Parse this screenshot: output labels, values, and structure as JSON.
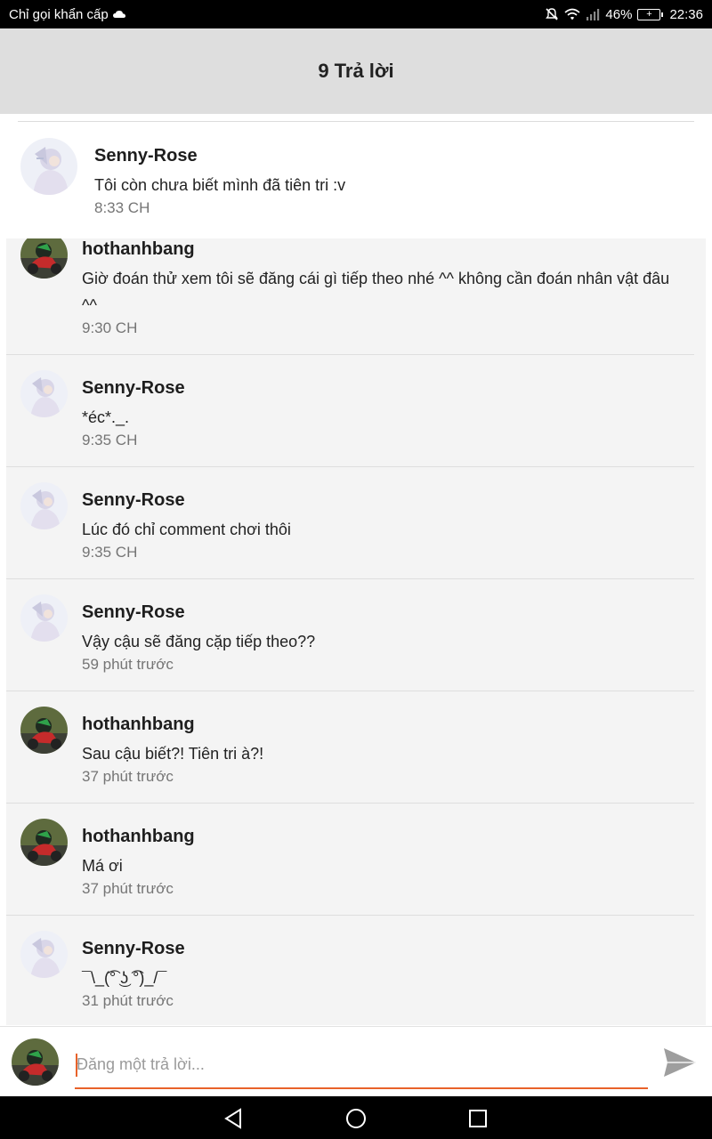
{
  "status_bar": {
    "carrier": "Chỉ gọi khẩn cấp",
    "battery": "46%",
    "time": "22:36"
  },
  "header": {
    "title": "9 Trả lời"
  },
  "top_comment": {
    "author": "Senny-Rose",
    "text": "Tôi còn chưa biết mình đã tiên tri :v",
    "time": "8:33 CH",
    "avatar": "senny-rose-avatar"
  },
  "replies": [
    {
      "author": "hothanhbang",
      "text": "Giờ đoán thử xem tôi sẽ đăng cái gì tiếp theo nhé ^^ không cần đoán nhân vật đâu ^^",
      "time": "9:30 CH",
      "avatar": "hothanhbang-avatar"
    },
    {
      "author": "Senny-Rose",
      "text": "*éc*._.",
      "time": "9:35 CH",
      "avatar": "senny-rose-avatar"
    },
    {
      "author": "Senny-Rose",
      "text": "Lúc đó chỉ comment chơi thôi",
      "time": "9:35 CH",
      "avatar": "senny-rose-avatar"
    },
    {
      "author": "Senny-Rose",
      "text": "Vậy cậu sẽ đăng cặp tiếp theo??",
      "time": "59 phút trước",
      "avatar": "senny-rose-avatar"
    },
    {
      "author": "hothanhbang",
      "text": "Sau cậu biết?! Tiên tri à?!",
      "time": "37 phút trước",
      "avatar": "hothanhbang-avatar"
    },
    {
      "author": "hothanhbang",
      "text": "Má ơi",
      "time": "37 phút trước",
      "avatar": "hothanhbang-avatar"
    },
    {
      "author": "Senny-Rose",
      "text": "¯\\_(͡° ͜ʖ ͡°)_/¯",
      "time": "31 phút trước",
      "avatar": "senny-rose-avatar"
    }
  ],
  "composer": {
    "placeholder": "Đăng một trả lời...",
    "value": ""
  },
  "colors": {
    "accent": "#e8622a",
    "header_bg": "#dedede",
    "list_bg": "#f4f4f4"
  }
}
